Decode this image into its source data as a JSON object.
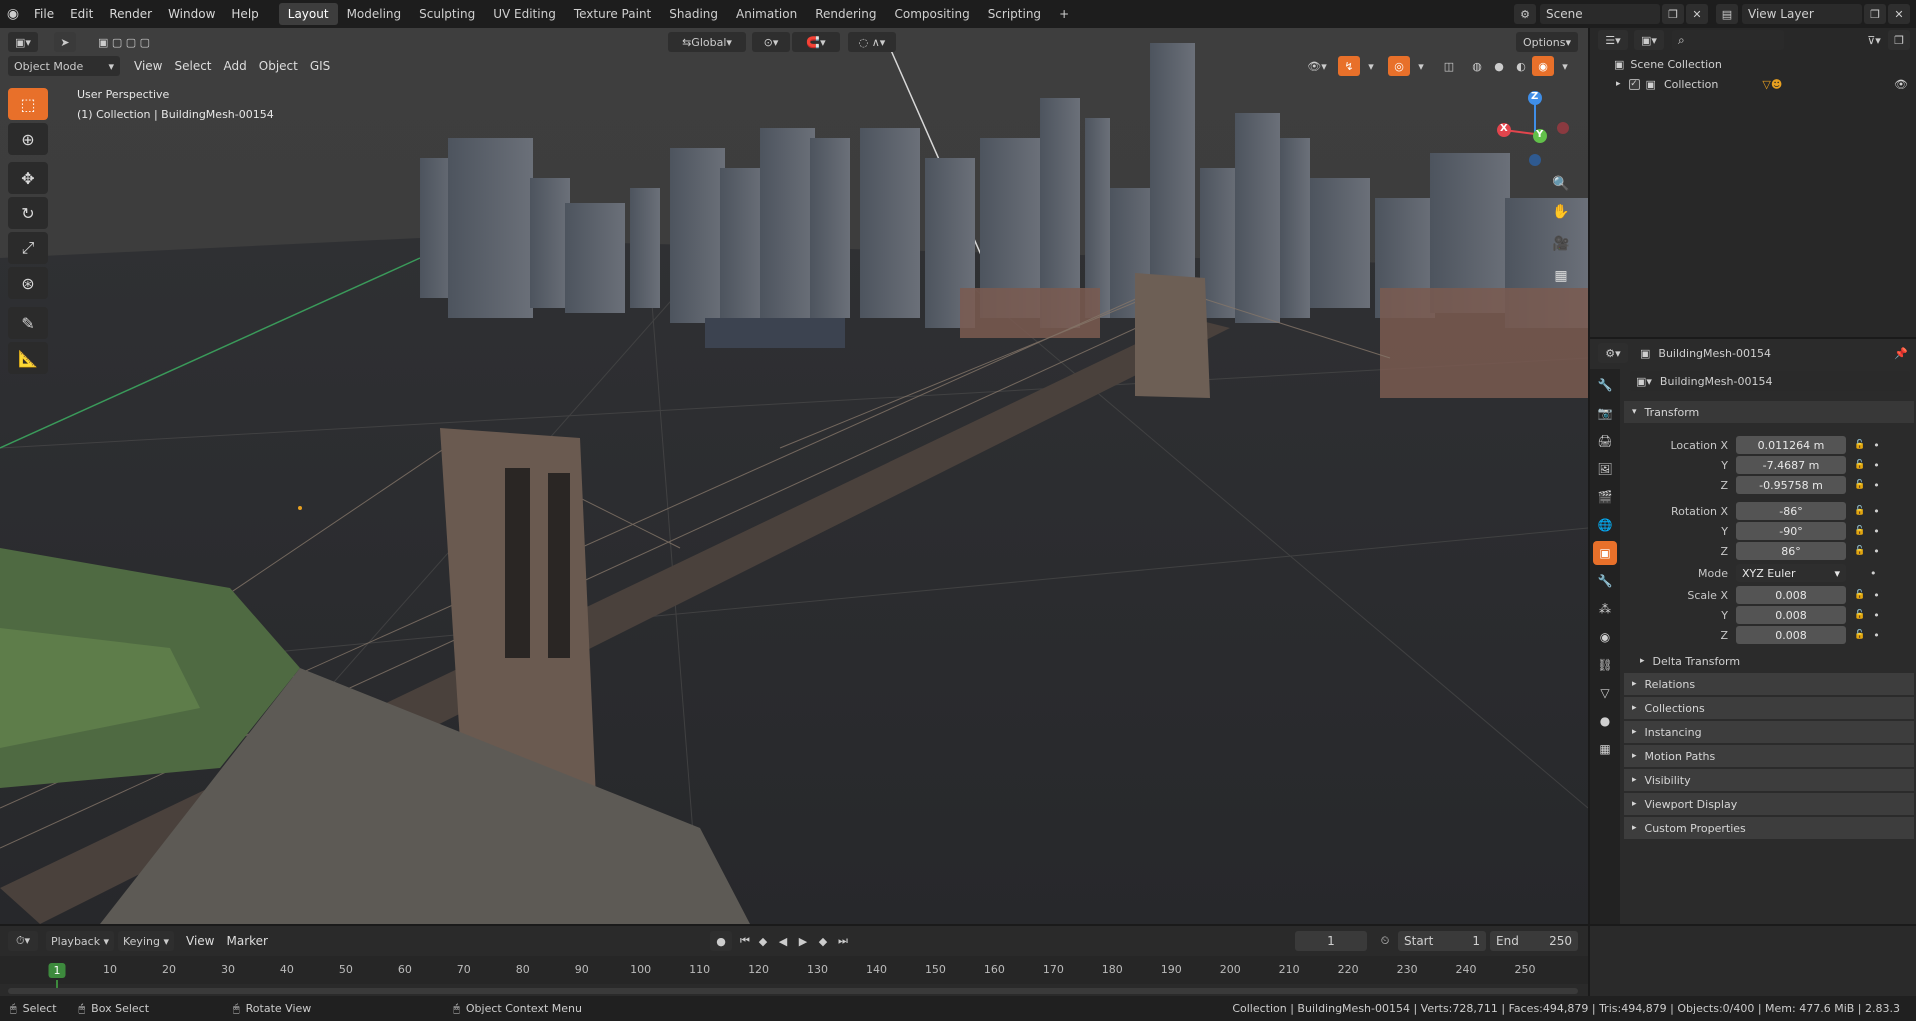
{
  "menus": [
    "File",
    "Edit",
    "Render",
    "Window",
    "Help"
  ],
  "workspaces": [
    "Layout",
    "Modeling",
    "Sculpting",
    "UV Editing",
    "Texture Paint",
    "Shading",
    "Animation",
    "Rendering",
    "Compositing",
    "Scripting"
  ],
  "active_workspace": "Layout",
  "scene": {
    "label": "Scene",
    "view_layer": "View Layer"
  },
  "viewport": {
    "mode": "Object Mode",
    "menus": [
      "View",
      "Select",
      "Add",
      "Object",
      "GIS"
    ],
    "transform_orientation": "Global",
    "options_label": "Options",
    "perspective_label": "User Perspective",
    "context_label": "(1) Collection | BuildingMesh-00154",
    "gizmo": {
      "x": "X",
      "y": "Y",
      "z": "Z"
    }
  },
  "outliner": {
    "root": "Scene Collection",
    "collection": "Collection"
  },
  "properties": {
    "object_name": "BuildingMesh-00154",
    "data_name": "BuildingMesh-00154",
    "transform_title": "Transform",
    "location": {
      "label": "Location X",
      "x": "0.011264 m",
      "y": "-7.4687 m",
      "z": "-0.95758 m"
    },
    "rotation": {
      "label": "Rotation X",
      "x": "-86°",
      "y": "-90°",
      "z": "86°"
    },
    "mode_label": "Mode",
    "mode_value": "XYZ Euler",
    "scale": {
      "label": "Scale X",
      "x": "0.008",
      "y": "0.008",
      "z": "0.008"
    },
    "axis_y": "Y",
    "axis_z": "Z",
    "delta": "Delta Transform",
    "panels": [
      "Relations",
      "Collections",
      "Instancing",
      "Motion Paths",
      "Visibility",
      "Viewport Display",
      "Custom Properties"
    ]
  },
  "timeline": {
    "menus": [
      "Playback",
      "Keying",
      "View",
      "Marker"
    ],
    "current_frame": "1",
    "start_label": "Start",
    "start": "1",
    "end_label": "End",
    "end": "250",
    "ticks": [
      "1",
      "10",
      "20",
      "30",
      "40",
      "50",
      "60",
      "70",
      "80",
      "90",
      "100",
      "110",
      "120",
      "130",
      "140",
      "150",
      "160",
      "170",
      "180",
      "190",
      "200",
      "210",
      "220",
      "230",
      "240",
      "250"
    ]
  },
  "status": {
    "select": "Select",
    "box_select": "Box Select",
    "rotate_view": "Rotate View",
    "context_menu": "Object Context Menu",
    "stats": "Collection | BuildingMesh-00154 | Verts:728,711 | Faces:494,879 | Tris:494,879 | Objects:0/400 | Mem: 477.6 MiB | 2.83.3"
  },
  "colors": {
    "accent": "#e8702a",
    "x_axis": "#e2454d",
    "y_axis": "#62c04a",
    "z_axis": "#3f8ee8"
  }
}
